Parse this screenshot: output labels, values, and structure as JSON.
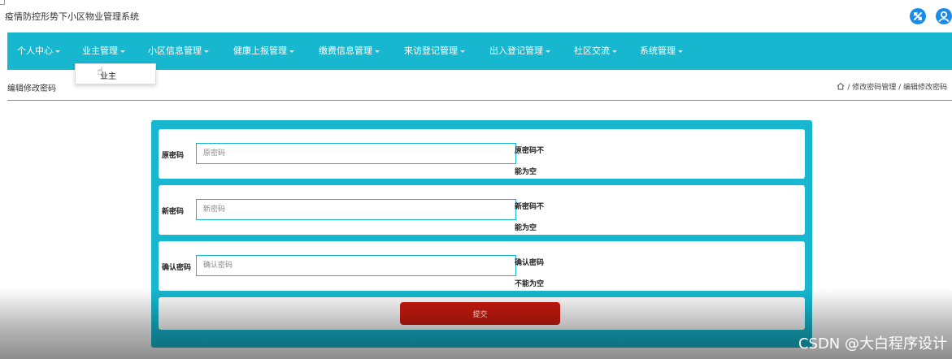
{
  "app": {
    "title": "疫情防控形势下小区物业管理系统"
  },
  "header_icons": [
    {
      "name": "fullscreen-icon",
      "color": "#1a8be8"
    },
    {
      "name": "user-icon",
      "color": "#1a8be8"
    }
  ],
  "nav": {
    "items": [
      {
        "label": "个人中心"
      },
      {
        "label": "业主管理"
      },
      {
        "label": "小区信息管理"
      },
      {
        "label": "健康上报管理"
      },
      {
        "label": "缴费信息管理"
      },
      {
        "label": "来访登记管理"
      },
      {
        "label": "出入登记管理"
      },
      {
        "label": "社区交流"
      },
      {
        "label": "系统管理"
      }
    ],
    "dropdown": {
      "label": "业主"
    }
  },
  "page": {
    "title": "编辑修改密码",
    "breadcrumb": "/ 修改密码管理 / 编辑修改密码"
  },
  "form": {
    "fields": [
      {
        "label": "原密码",
        "placeholder": "原密码",
        "error_line1": "原密码不",
        "error_line2": "能为空"
      },
      {
        "label": "新密码",
        "placeholder": "新密码",
        "error_line1": "新密码不",
        "error_line2": "能为空"
      },
      {
        "label": "确认密码",
        "placeholder": "确认密码",
        "error_line1": "确认密码",
        "error_line2": "不能为空"
      }
    ],
    "submit_label": "提交"
  },
  "watermark": "CSDN @大白程序设计",
  "colors": {
    "accent": "#17b8cf",
    "submit": "#cc1a0f",
    "icon": "#1a8be8"
  }
}
